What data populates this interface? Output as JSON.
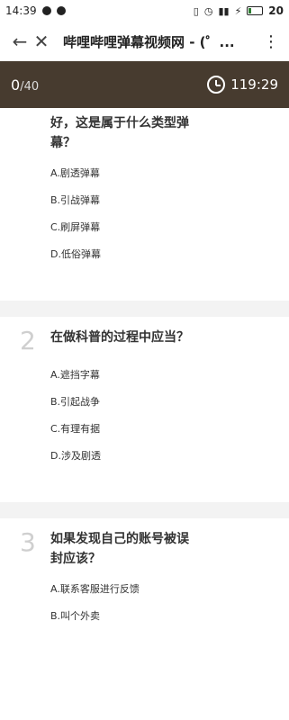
{
  "status": {
    "time": "14:39",
    "battery": "20"
  },
  "browser": {
    "title": "哔哩哔哩弹幕视频网 - (゜..."
  },
  "quiz": {
    "progress_current": "0",
    "progress_total": "/40",
    "timer": "119:29"
  },
  "questions": [
    {
      "number": "",
      "text_lines": [
        "好，这是属于什么类型弹",
        "幕？"
      ],
      "options": [
        "A.剧透弹幕",
        "B.引战弹幕",
        "C.刷屏弹幕",
        "D.低俗弹幕"
      ]
    },
    {
      "number": "2",
      "text_lines": [
        "在做科普的过程中应当？"
      ],
      "options": [
        "A.遮挡字幕",
        "B.引起战争",
        "C.有理有据",
        "D.涉及剧透"
      ]
    },
    {
      "number": "3",
      "text_lines": [
        "如果发现自己的账号被误",
        "封应该？"
      ],
      "options": [
        "A.联系客服进行反馈",
        "B.叫个外卖"
      ]
    }
  ]
}
